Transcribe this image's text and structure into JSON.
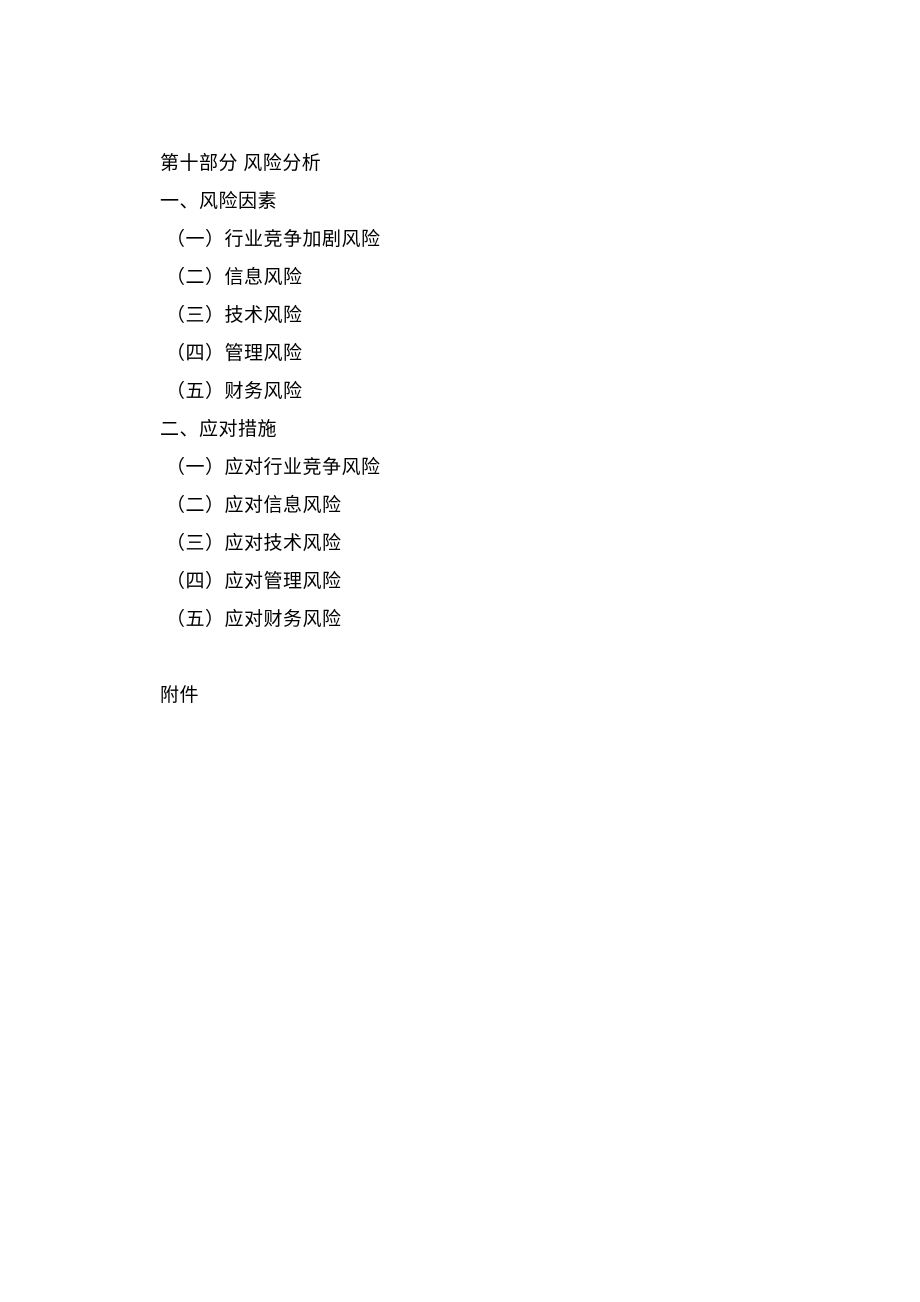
{
  "section": {
    "title": "第十部分 风险分析",
    "groups": [
      {
        "heading": "一、风险因素",
        "items": [
          "（一）行业竞争加剧风险",
          "（二）信息风险",
          "（三）技术风险",
          "（四）管理风险",
          "（五）财务风险"
        ]
      },
      {
        "heading": "二、应对措施",
        "items": [
          "（一）应对行业竞争风险",
          "（二）应对信息风险",
          "（三）应对技术风险",
          "（四）应对管理风险",
          "（五）应对财务风险"
        ]
      }
    ],
    "appendix": "附件"
  }
}
